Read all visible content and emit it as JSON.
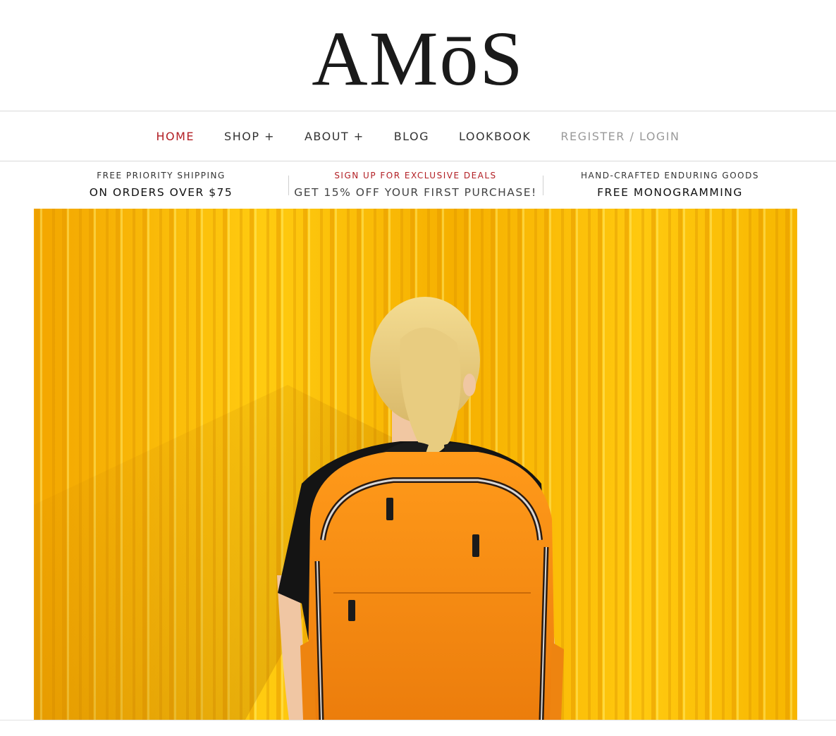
{
  "brand": {
    "logo_text": "AMōS"
  },
  "nav": {
    "items": [
      {
        "label": "HOME",
        "state": "active"
      },
      {
        "label": "SHOP +",
        "state": "normal"
      },
      {
        "label": "ABOUT +",
        "state": "normal"
      },
      {
        "label": "BLOG",
        "state": "normal"
      },
      {
        "label": "LOOKBOOK",
        "state": "normal"
      },
      {
        "label": "REGISTER / LOGIN",
        "state": "muted"
      }
    ]
  },
  "promos": [
    {
      "kicker": "FREE PRIORITY SHIPPING",
      "headline": "ON ORDERS OVER $75"
    },
    {
      "kicker": "SIGN UP FOR EXCLUSIVE DEALS",
      "headline": "GET 15% OFF YOUR FIRST PURCHASE!"
    },
    {
      "kicker": "HAND-CRAFTED ENDURING GOODS",
      "headline": "FREE MONOGRAMMING"
    }
  ],
  "colors": {
    "accent_red": "#b21f24",
    "text_dark": "#333333",
    "muted": "#9a9a9a",
    "hero_yellow": "#ffc20e",
    "backpack_orange": "#f08a10"
  }
}
